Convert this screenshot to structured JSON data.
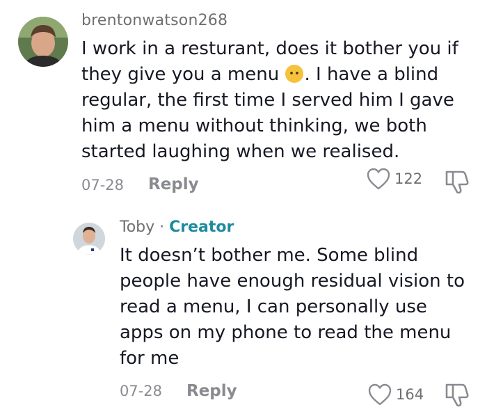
{
  "comment": {
    "username": "brentonwatson268",
    "text_part1": "I work in a resturant, does it bother you if they give you a menu ",
    "text_part2": ". I have a blind regular, the first time I served him I gave him a menu without thinking, we both started laughing when we realised.",
    "emoji": "awkward-face-emoji",
    "date": "07-28",
    "reply_label": "Reply",
    "likes": "122"
  },
  "reply": {
    "author": "Toby",
    "separator": " · ",
    "badge": "Creator",
    "text": "It doesn’t bother me. Some blind people have enough residual vision to read a menu, I can personally use apps on my phone to read the menu for me",
    "date": "07-28",
    "reply_label": "Reply",
    "likes": "164"
  },
  "colors": {
    "text": "#161823",
    "secondary": "#8a8b91",
    "creator": "#1d8b9e",
    "emoji": "#f6c23c"
  }
}
